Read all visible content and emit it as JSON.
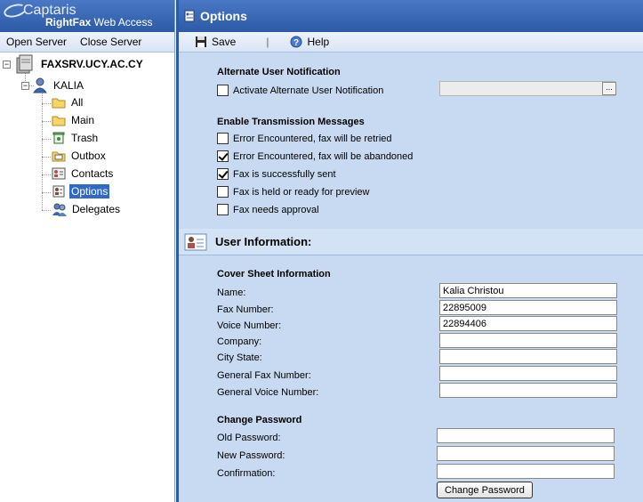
{
  "app": {
    "brand_logo_text": "Captaris",
    "brand_product_bold": "RightFax",
    "brand_product_rest": " Web Access"
  },
  "menubar": {
    "open_server": "Open Server",
    "close_server": "Close Server"
  },
  "tree": {
    "server": "FAXSRV.UCY.AC.CY",
    "user": "KALIA",
    "folders": [
      {
        "label": "All",
        "icon": "folder-icon"
      },
      {
        "label": "Main",
        "icon": "folder-icon"
      },
      {
        "label": "Trash",
        "icon": "trash-icon"
      },
      {
        "label": "Outbox",
        "icon": "outbox-icon"
      },
      {
        "label": "Contacts",
        "icon": "contacts-icon"
      },
      {
        "label": "Options",
        "icon": "options-icon",
        "selected": true
      },
      {
        "label": "Delegates",
        "icon": "delegates-icon"
      }
    ]
  },
  "page": {
    "title": "Options"
  },
  "toolbar": {
    "save_label": "Save",
    "separator": "|",
    "help_label": "Help"
  },
  "alt_notification": {
    "heading": "Alternate User Notification",
    "checkbox_label": "Activate Alternate User Notification",
    "checked": false,
    "field_value": "",
    "browse_label": "..."
  },
  "transmission": {
    "heading": "Enable Transmission Messages",
    "options": [
      {
        "label": "Error Encountered, fax will be retried",
        "checked": false
      },
      {
        "label": "Error Encountered, fax will be abandoned",
        "checked": true
      },
      {
        "label": "Fax is successfully sent",
        "checked": true
      },
      {
        "label": "Fax is held or ready for preview",
        "checked": false
      },
      {
        "label": "Fax needs approval",
        "checked": false
      }
    ]
  },
  "user_info": {
    "band_title": "User Information:",
    "cover_heading": "Cover Sheet Information",
    "fields": [
      {
        "label": "Name:",
        "value": "Kalia Christou"
      },
      {
        "label": "Fax Number:",
        "value": "22895009"
      },
      {
        "label": "Voice Number:",
        "value": "22894406"
      },
      {
        "label": "Company:",
        "value": ""
      },
      {
        "label": "City State:",
        "value": ""
      },
      {
        "label": "General Fax Number:",
        "value": ""
      },
      {
        "label": "General Voice Number:",
        "value": ""
      }
    ]
  },
  "password": {
    "heading": "Change Password",
    "fields": [
      {
        "label": "Old Password:",
        "value": ""
      },
      {
        "label": "New Password:",
        "value": ""
      },
      {
        "label": "Confirmation:",
        "value": ""
      }
    ],
    "button_label": "Change Password"
  },
  "colors": {
    "header_blue": "#2c5aa7",
    "content_bg": "#c8daf2",
    "selection": "#316ac5"
  }
}
